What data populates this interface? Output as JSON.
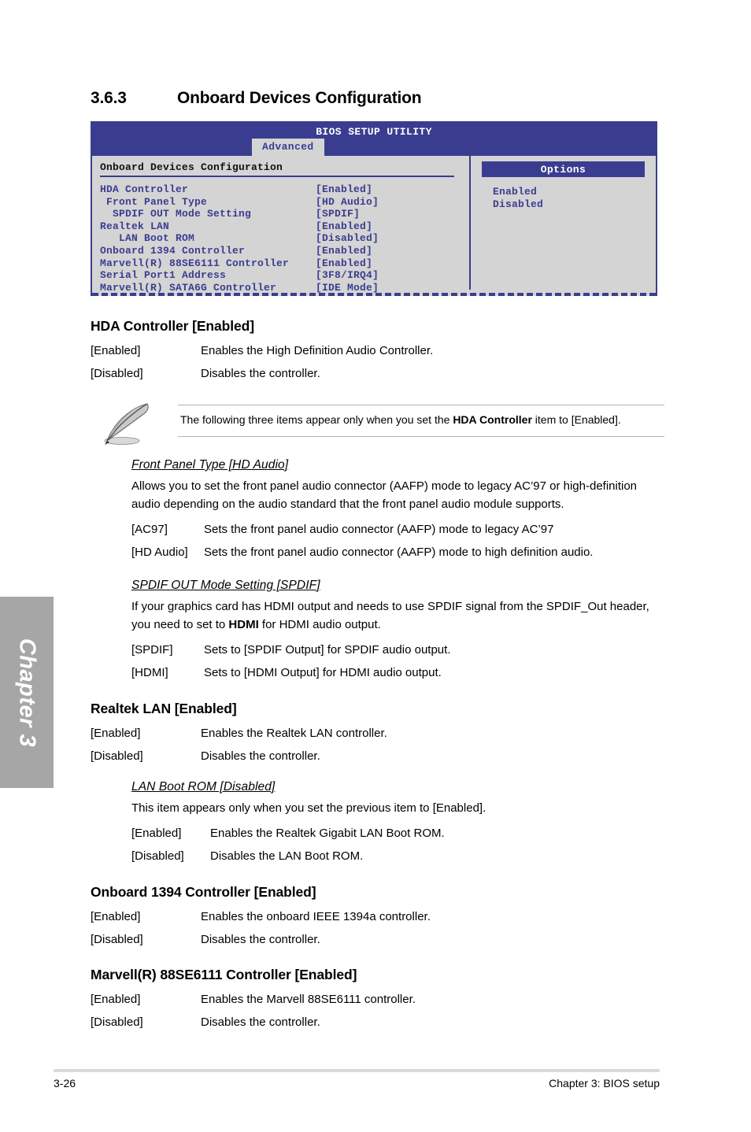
{
  "chapter_tab": {
    "label": "Chapter 3"
  },
  "section": {
    "number": "3.6.3",
    "title": "Onboard Devices Configuration"
  },
  "bios": {
    "utility_title": "BIOS SETUP UTILITY",
    "active_tab": "Advanced",
    "panel_title": "Onboard Devices Configuration",
    "rows": [
      {
        "key": "HDA Controller",
        "value": "[Enabled]"
      },
      {
        "key": " Front Panel Type",
        "value": "[HD Audio]"
      },
      {
        "key": "  SPDIF OUT Mode Setting",
        "value": "[SPDIF]"
      },
      {
        "key": "Realtek LAN",
        "value": "[Enabled]"
      },
      {
        "key": "   LAN Boot ROM",
        "value": "[Disabled]"
      },
      {
        "key": "Onboard 1394 Controller",
        "value": "[Enabled]"
      },
      {
        "key": "Marvell(R) 88SE6111 Controller",
        "value": "[Enabled]"
      },
      {
        "key": "Serial Port1 Address",
        "value": "[3F8/IRQ4]"
      },
      {
        "key": "Marvell(R) SATA6G Controller",
        "value": "[IDE Mode]"
      }
    ],
    "options_header": "Options",
    "options": [
      "Enabled",
      "Disabled"
    ],
    "colors": {
      "blue": "#3a3d8f",
      "panel_bg": "#d4d4d4"
    }
  },
  "content": {
    "hda": {
      "heading": "HDA Controller [Enabled]",
      "rows": [
        {
          "key": "[Enabled]",
          "value": "Enables the High Definition Audio Controller."
        },
        {
          "key": "[Disabled]",
          "value": "Disables the controller."
        }
      ]
    },
    "note": {
      "text_before": "The following three items appear only when you set the ",
      "bold": "HDA Controller",
      "text_after": " item to [Enabled].",
      "icon": "quill-pen-icon"
    },
    "front_panel": {
      "heading": "Front Panel Type [HD Audio]",
      "paragraph": "Allows you to set the front panel audio connector (AAFP) mode to legacy AC’97 or high-definition audio depending on the audio standard that the front panel audio module supports.",
      "rows": [
        {
          "key": "[AC97]",
          "value": "Sets the front panel audio connector (AAFP) mode to legacy AC’97"
        },
        {
          "key": "[HD Audio]",
          "value": "Sets the front panel audio connector (AAFP) mode to high definition audio."
        }
      ]
    },
    "spdif": {
      "heading": "SPDIF OUT Mode Setting [SPDIF]",
      "para_before": "If your graphics card has HDMI output and needs to use SPDIF signal from the SPDIF_Out header, you need to set to ",
      "para_bold": "HDMI",
      "para_after": " for HDMI audio output.",
      "rows": [
        {
          "key": "[SPDIF]",
          "value": "Sets to [SPDIF Output] for SPDIF audio output."
        },
        {
          "key": "[HDMI]",
          "value": "Sets to [HDMI Output] for HDMI audio output."
        }
      ]
    },
    "realtek": {
      "heading": "Realtek LAN [Enabled]",
      "rows": [
        {
          "key": "[Enabled]",
          "value": "Enables the Realtek LAN controller."
        },
        {
          "key": "[Disabled]",
          "value": "Disables the controller."
        }
      ]
    },
    "lan_boot_rom": {
      "heading": "LAN Boot ROM [Disabled]",
      "paragraph": "This item appears only when you set the previous item to [Enabled].",
      "rows": [
        {
          "key": "[Enabled]",
          "value": "Enables the Realtek Gigabit LAN Boot ROM."
        },
        {
          "key": "[Disabled]",
          "value": "Disables the LAN Boot ROM."
        }
      ]
    },
    "onboard_1394": {
      "heading": "Onboard 1394 Controller [Enabled]",
      "rows": [
        {
          "key": "[Enabled]",
          "value": "Enables the onboard IEEE 1394a controller."
        },
        {
          "key": "[Disabled]",
          "value": "Disables the controller."
        }
      ]
    },
    "marvell": {
      "heading": "Marvell(R) 88SE6111 Controller [Enabled]",
      "rows": [
        {
          "key": "[Enabled]",
          "value": "Enables the Marvell 88SE6111 controller."
        },
        {
          "key": "[Disabled]",
          "value": "Disables the controller."
        }
      ]
    }
  },
  "footer": {
    "page_number": "3-26",
    "chapter_label": "Chapter 3: BIOS setup"
  }
}
